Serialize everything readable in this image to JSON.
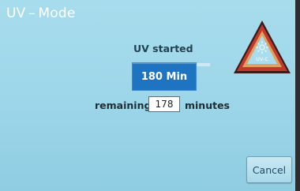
{
  "window": {
    "title": "UV – Mode"
  },
  "uv": {
    "status": "UV started",
    "duration_label": "180 Min",
    "remaining_label": "remaining:",
    "remaining_value": "178",
    "remaining_unit": "minutes",
    "warning_icon": "uv-c-hazard-triangle",
    "warning_text": "UV-C"
  },
  "actions": {
    "cancel_label": "Cancel"
  },
  "colors": {
    "background": "#9fd7ea",
    "duration_button": "#1f74c2",
    "warning_border": "#c0392b",
    "warning_fill": "#e8a766"
  }
}
